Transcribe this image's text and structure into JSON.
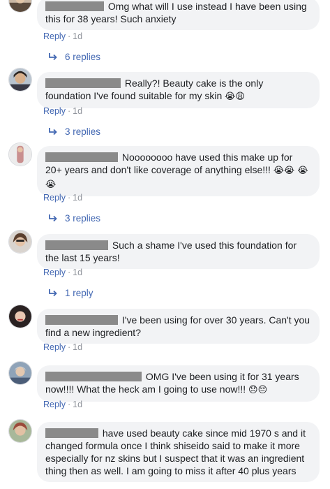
{
  "comments": [
    {
      "text": " Omg what will I use instead I have been using this for 38 years! Such anxiety",
      "emoji": "",
      "reply": "Reply",
      "time": "1d",
      "replies": "6 replies"
    },
    {
      "text": " Really?! Beauty cake is the only foundation I've found suitable for my skin ",
      "emoji": "😭😩",
      "reply": "Reply",
      "time": "1d",
      "replies": "3 replies"
    },
    {
      "text": " Noooooooo have used this make up for 20+ years and don't like coverage of anything else!!! ",
      "emoji": "😭😭 😭😭",
      "reply": "Reply",
      "time": "1d",
      "replies": "3 replies"
    },
    {
      "text": " Such a shame I've used this foundation for the last 15 years!",
      "emoji": "",
      "reply": "Reply",
      "time": "1d",
      "replies": "1 reply"
    },
    {
      "text": " I've been using for over 30 years. Can't you find a new ingredient?",
      "emoji": "",
      "reply": "Reply",
      "time": "1d",
      "replies": ""
    },
    {
      "text": " OMG I've been using it for 31 years now!!!! What the heck am I going to use now!!! ",
      "emoji": "😞😔",
      "reply": "Reply",
      "time": "1d",
      "replies": ""
    },
    {
      "text": " have used beauty cake since mid 1970 s and it changed formula once I think shiseido said to make it more especially for nz skins but I suspect that it was an ingredient thing then as well. I am going to miss it after 40 plus years",
      "emoji": "",
      "reply": "",
      "time": "",
      "replies": ""
    }
  ],
  "separator": "·",
  "colors": {
    "link": "#4267b2",
    "meta": "#90949c",
    "bubble": "#f2f3f5",
    "text": "#1c1e21",
    "redaction": "#8a8a8a"
  }
}
